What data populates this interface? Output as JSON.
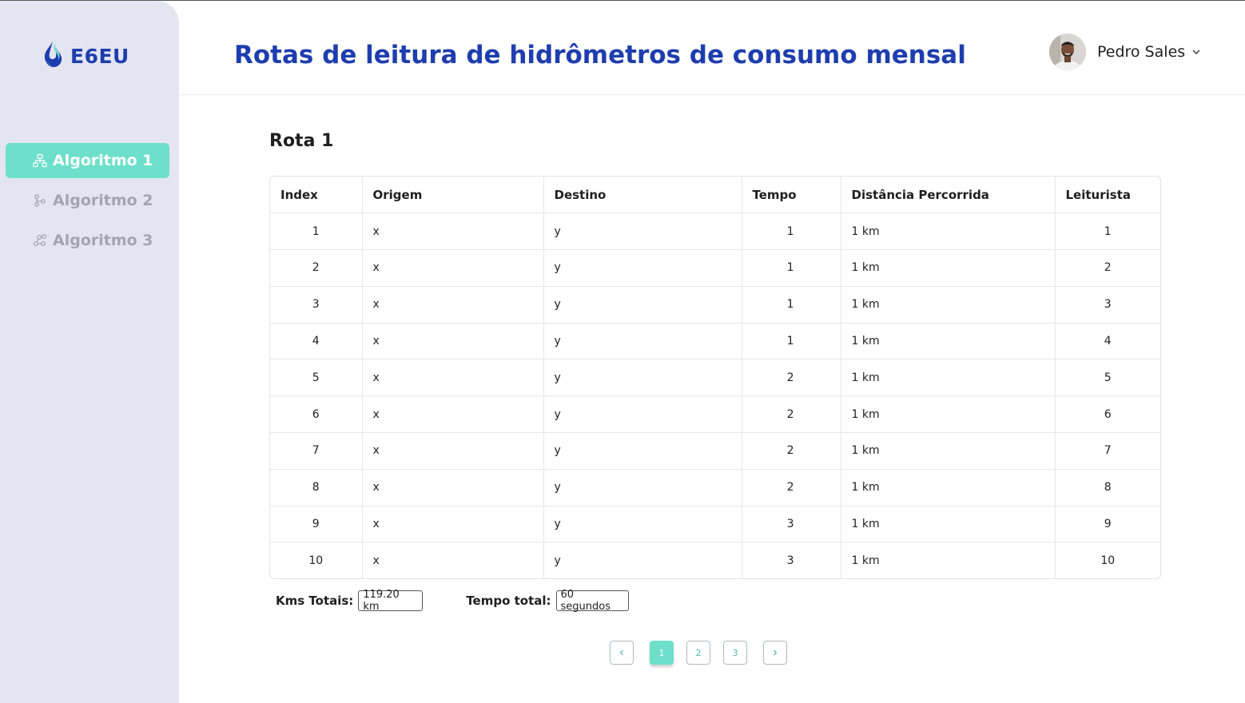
{
  "brand": {
    "name": "E6EU",
    "color": "#1e3dae",
    "accent": "#6ddfca"
  },
  "sidebar": {
    "items": [
      {
        "label": "Algoritmo 1",
        "icon": "hierarchy-icon",
        "active": true
      },
      {
        "label": "Algoritmo 2",
        "icon": "git-branch-icon",
        "active": false
      },
      {
        "label": "Algoritmo 3",
        "icon": "nodes-icon",
        "active": false
      }
    ]
  },
  "header": {
    "title": "Rotas de leitura de hidrômetros de consumo mensal",
    "user_name": "Pedro Sales"
  },
  "route": {
    "title": "Rota 1",
    "columns": [
      "Index",
      "Origem",
      "Destino",
      "Tempo",
      "Distância Percorrida",
      "Leiturista"
    ],
    "rows": [
      [
        "1",
        "x",
        "y",
        "1",
        "1 km",
        "1"
      ],
      [
        "2",
        "x",
        "y",
        "1",
        "1 km",
        "2"
      ],
      [
        "3",
        "x",
        "y",
        "1",
        "1 km",
        "3"
      ],
      [
        "4",
        "x",
        "y",
        "1",
        "1 km",
        "4"
      ],
      [
        "5",
        "x",
        "y",
        "2",
        "1 km",
        "5"
      ],
      [
        "6",
        "x",
        "y",
        "2",
        "1 km",
        "6"
      ],
      [
        "7",
        "x",
        "y",
        "2",
        "1 km",
        "7"
      ],
      [
        "8",
        "x",
        "y",
        "2",
        "1 km",
        "8"
      ],
      [
        "9",
        "x",
        "y",
        "3",
        "1 km",
        "9"
      ],
      [
        "10",
        "x",
        "y",
        "3",
        "1 km",
        "10"
      ]
    ]
  },
  "totals": {
    "km_label": "Kms Totais:",
    "km_value": "119.20 km",
    "time_label": "Tempo total:",
    "time_value": "60 segundos"
  },
  "pagination": {
    "pages": [
      "1",
      "2",
      "3"
    ],
    "current": "1"
  }
}
